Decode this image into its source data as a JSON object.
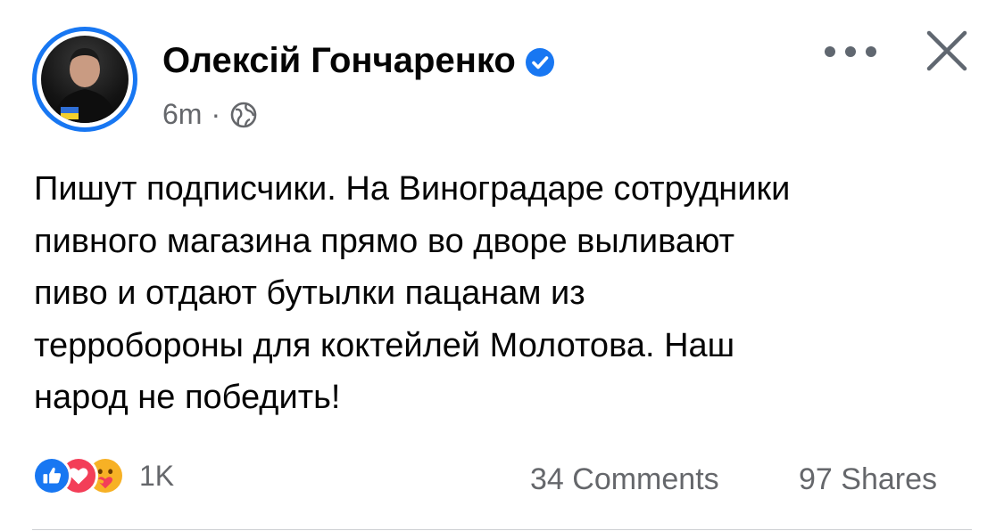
{
  "post": {
    "author": "Олексій Гончаренко",
    "verified_icon": "verified-badge-icon",
    "time": "6m",
    "separator": "·",
    "audience_icon": "globe-icon",
    "text_lines": [
      "Пишут подписчики. На Виноградаре сотрудники",
      "пивного магазина прямо во дворе выливают",
      "пиво и отдают бутылки пацанам из",
      "терробороны для коктейлей Молотова. Наш",
      "народ не победить!"
    ]
  },
  "footer": {
    "reaction_icons": [
      "like-icon",
      "love-icon",
      "care-icon"
    ],
    "reactions_count": "1K",
    "comments": "34 Comments",
    "shares": "97 Shares"
  },
  "colors": {
    "brand_blue": "#1877f2",
    "love_red": "#f33e58",
    "care_yellow": "#f7b125",
    "secondary_text": "#65676b",
    "primary_text": "#050505"
  }
}
